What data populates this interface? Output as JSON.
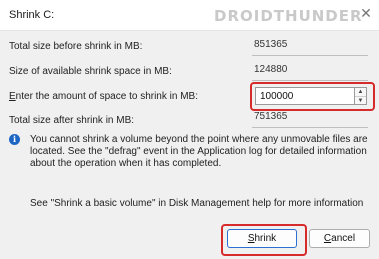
{
  "window": {
    "title": "Shrink C:",
    "watermark": "DROIDTHUNDER"
  },
  "fields": {
    "total_before": {
      "label": "Total size before shrink in MB:",
      "value": "851365"
    },
    "available": {
      "label": "Size of available shrink space in MB:",
      "value": "124880"
    },
    "amount": {
      "label_pre": "E",
      "label_post": "nter the amount of space to shrink in MB:",
      "value": "100000"
    },
    "total_after": {
      "label": "Total size after shrink in MB:",
      "value": "751365"
    }
  },
  "info": {
    "text": "You cannot shrink a volume beyond the point where any unmovable files are located. See the \"defrag\" event in the Application log for detailed information about the operation when it has completed.",
    "help": "See \"Shrink a basic volume\" in Disk Management help for more information"
  },
  "buttons": {
    "shrink_pre": "S",
    "shrink_post": "hrink",
    "cancel_pre": "C",
    "cancel_post": "ancel"
  },
  "colors": {
    "highlight": "#d72a2a",
    "info_icon": "#1e66c4",
    "primary_border": "#2a6fd2"
  }
}
